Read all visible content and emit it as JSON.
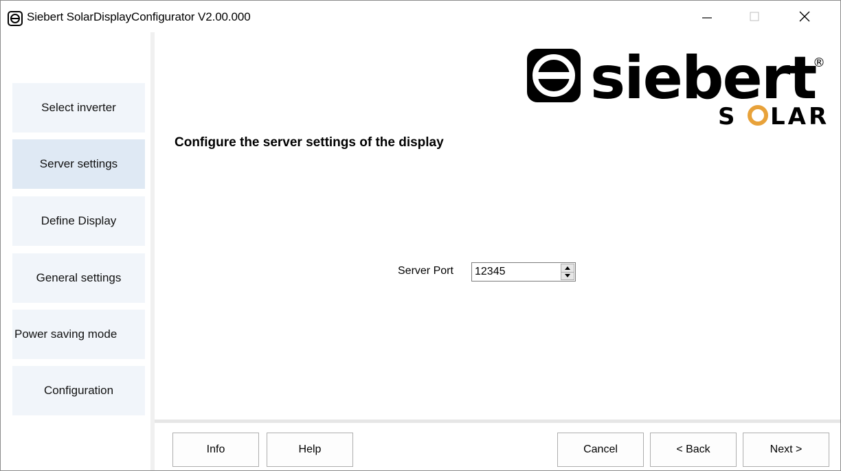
{
  "window": {
    "title": "Siebert SolarDisplayConfigurator V2.00.000",
    "app_icon": "siebert-app-icon",
    "controls": {
      "minimize": "minimize-icon",
      "maximize": "maximize-icon",
      "close": "close-icon"
    }
  },
  "sidebar": {
    "items": [
      {
        "label": "Select inverter",
        "active": false
      },
      {
        "label": "Server settings",
        "active": true
      },
      {
        "label": "Define Display",
        "active": false
      },
      {
        "label": "General settings",
        "active": false
      },
      {
        "label": "Power saving mode",
        "active": false
      },
      {
        "label": "Configuration",
        "active": false
      }
    ]
  },
  "logo": {
    "brand": "siebert",
    "sub": "SOLAR",
    "registered": "®"
  },
  "main": {
    "heading": "Configure the server settings of the display",
    "server_port_label": "Server Port",
    "server_port_value": "12345"
  },
  "footer": {
    "info": "Info",
    "help": "Help",
    "cancel": "Cancel",
    "back": "< Back",
    "next": "Next >"
  },
  "colors": {
    "sidebar_item_bg": "#f1f5fa",
    "sidebar_item_active_bg": "#dfe9f4",
    "logo_accent": "#e8a23a"
  }
}
